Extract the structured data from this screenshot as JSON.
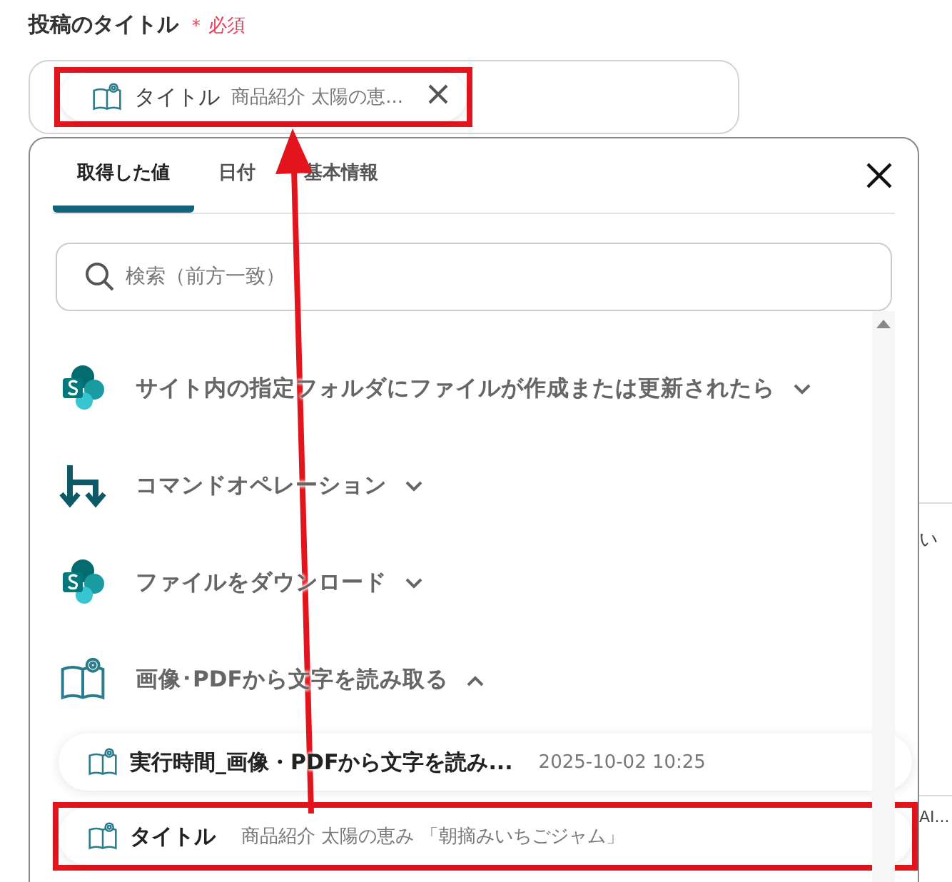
{
  "field": {
    "label": "投稿のタイトル",
    "required_mark": "＊",
    "required_text": "必須",
    "chip": {
      "name": "タイトル",
      "value": "商品紹介 太陽の恵...",
      "highlighted": true
    }
  },
  "panel": {
    "tabs": [
      {
        "label": "取得した値",
        "selected": true
      },
      {
        "label": "日付",
        "selected": false
      },
      {
        "label": "基本情報",
        "selected": false
      }
    ],
    "search": {
      "placeholder": "検索（前方一致）"
    },
    "groups": [
      {
        "kind": "sharepoint",
        "title": "サイト内の指定フォルダにファイルが作成または更新されたら",
        "expanded": false
      },
      {
        "kind": "command",
        "title": "コマンドオペレーション",
        "expanded": false
      },
      {
        "kind": "sharepoint",
        "title": "ファイルをダウンロード",
        "expanded": false
      },
      {
        "kind": "ocr",
        "title": "画像･PDFから文字を読み取る",
        "expanded": true,
        "items": [
          {
            "name": "実行時間_画像・PDFから文字を読み...",
            "value": "2025-10-02 10:25",
            "highlighted": false
          },
          {
            "name": "タイトル",
            "value": "商品紹介 太陽の恵み 「朝摘みいちごジャム」",
            "highlighted": true
          }
        ]
      }
    ]
  },
  "background": {
    "texts": [
      "い",
      "AI..."
    ]
  }
}
